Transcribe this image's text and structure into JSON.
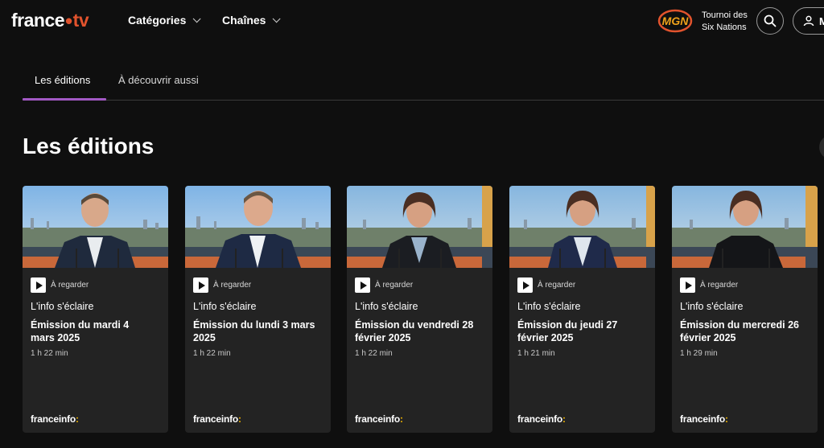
{
  "header": {
    "logo_france": "france",
    "logo_dot": "•",
    "logo_tv": "tv",
    "nav": [
      {
        "label": "Catégories"
      },
      {
        "label": "Chaînes"
      }
    ],
    "promo": {
      "line1": "Tournoi des",
      "line2": "Six Nations"
    },
    "account_label": "M"
  },
  "tabs": [
    {
      "label": "Les éditions",
      "active": true
    },
    {
      "label": "À découvrir aussi",
      "active": false
    }
  ],
  "section_title": "Les éditions",
  "cards": [
    {
      "badge": "À regarder",
      "program": "L'info s'éclaire",
      "episode_l1": "Émission du mardi 4",
      "episode_l2": "mars 2025",
      "duration": "1 h 22 min",
      "channel": "franceinfo",
      "channel_suffix": ":"
    },
    {
      "badge": "À regarder",
      "program": "L'info s'éclaire",
      "episode_l1": "Émission du lundi 3 mars",
      "episode_l2": "2025",
      "duration": "1 h 22 min",
      "channel": "franceinfo",
      "channel_suffix": ":"
    },
    {
      "badge": "À regarder",
      "program": "L'info s'éclaire",
      "episode_l1": "Émission du vendredi 28",
      "episode_l2": "février 2025",
      "duration": "1 h 22 min",
      "channel": "franceinfo",
      "channel_suffix": ":"
    },
    {
      "badge": "À regarder",
      "program": "L'info s'éclaire",
      "episode_l1": "Émission du jeudi 27",
      "episode_l2": "février 2025",
      "duration": "1 h 21 min",
      "channel": "franceinfo",
      "channel_suffix": ":"
    },
    {
      "badge": "À regarder",
      "program": "L'info s'éclaire",
      "episode_l1": "Émission du mercredi 26",
      "episode_l2": "février 2025",
      "duration": "1 h 29 min",
      "channel": "franceinfo",
      "channel_suffix": ":"
    }
  ],
  "colors": {
    "background": "#0f0f0f",
    "card": "#232323",
    "accent_tab": "#a259c4",
    "brand_orange": "#e2532d",
    "channel_yellow": "#f5b800"
  },
  "icons": {
    "search": "search-icon",
    "account": "user-icon",
    "play": "play-icon",
    "chevron": "chevron-down-icon"
  }
}
